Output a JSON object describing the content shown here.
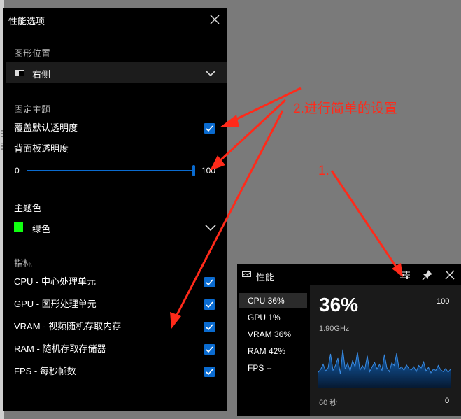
{
  "options_panel": {
    "title": "性能选项",
    "graph_position": {
      "section": "图形位置",
      "value": "右侧"
    },
    "pin_theme": {
      "section": "固定主题",
      "override_label": "覆盖默认透明度",
      "override_checked": true,
      "opacity_label": "背面板透明度",
      "opacity_min": "0",
      "opacity_max": "100",
      "opacity_value": 100
    },
    "theme_color": {
      "label": "主题色",
      "value": "绿色",
      "swatch": "#10ff10"
    },
    "metrics": {
      "section": "指标",
      "items": [
        {
          "label": "CPU - 中心处理单元",
          "checked": true
        },
        {
          "label": "GPU - 图形处理单元",
          "checked": true
        },
        {
          "label": "VRAM - 视频随机存取内存",
          "checked": true
        },
        {
          "label": "RAM - 随机存取存储器",
          "checked": true
        },
        {
          "label": "FPS - 每秒帧数",
          "checked": true
        }
      ]
    }
  },
  "perf_widget": {
    "title": "性能",
    "metrics": [
      {
        "label": "CPU  36%"
      },
      {
        "label": "GPU   1%"
      },
      {
        "label": "VRAM  36%"
      },
      {
        "label": "RAM  42%"
      },
      {
        "label": "FPS --"
      }
    ],
    "big_value": "36%",
    "max": "100",
    "frequency": "1.90GHz",
    "axis_left": "60 秒",
    "axis_right": "0",
    "usage_history": [
      25,
      30,
      38,
      27,
      32,
      55,
      28,
      36,
      48,
      22,
      62,
      30,
      40,
      27,
      44,
      34,
      58,
      28,
      36,
      30,
      52,
      26,
      34,
      41,
      30,
      38,
      28,
      54,
      32,
      26,
      40,
      36,
      56,
      30,
      34,
      28,
      37,
      31,
      29,
      34,
      26,
      36,
      32,
      42,
      27,
      33,
      24,
      30,
      28,
      36,
      29,
      26,
      31,
      25,
      30
    ],
    "accent": "#0a6bd0"
  },
  "annotations": {
    "step1": "1.",
    "step2": "2.进行简单的设置",
    "color": "#ff2a1a"
  }
}
